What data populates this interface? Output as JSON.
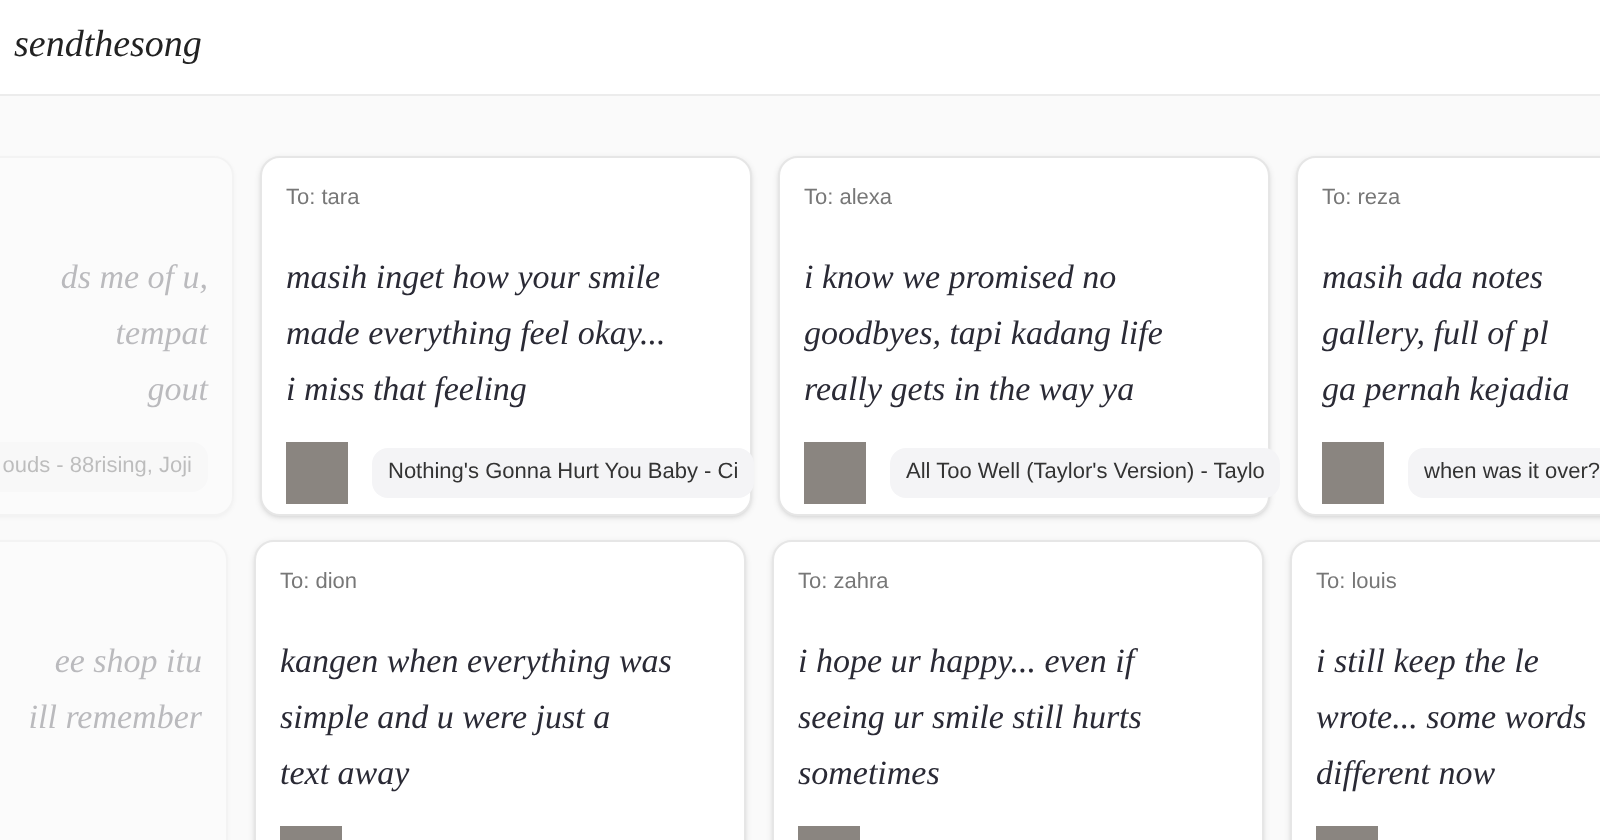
{
  "brand": "sendthesong",
  "rows": [
    {
      "cards": [
        {
          "faded": true,
          "lines": [
            "ds me of u,",
            "tempat",
            "gout"
          ],
          "song": "ouds - 88rising, Joji",
          "thumbnail": false
        },
        {
          "faded": false,
          "to": "To: tara",
          "lines": [
            "masih inget how your smile",
            "made everything feel okay...",
            "i miss that feeling"
          ],
          "song": "Nothing's Gonna Hurt You Baby - Ci",
          "thumbnail": true
        },
        {
          "faded": false,
          "to": "To: alexa",
          "lines": [
            "i know we promised no",
            "goodbyes, tapi kadang life",
            "really gets in the way ya"
          ],
          "song": "All Too Well (Taylor's Version) - Taylo",
          "thumbnail": true
        },
        {
          "faded": false,
          "to": "To: reza",
          "lines": [
            "masih ada notes",
            "gallery, full of pl",
            "ga pernah kejadia"
          ],
          "song": "when was it over?",
          "thumbnail": true
        }
      ]
    },
    {
      "cards": [
        {
          "faded": true,
          "lines": [
            "ee shop itu",
            "ill remember"
          ],
          "thumbnail": false
        },
        {
          "faded": false,
          "to": "To: dion",
          "lines": [
            "kangen when everything was",
            "simple and u were just a",
            "text away"
          ],
          "thumbnail": true
        },
        {
          "faded": false,
          "to": "To: zahra",
          "lines": [
            "i hope ur happy... even if",
            "seeing ur smile still hurts",
            "sometimes"
          ],
          "thumbnail": true
        },
        {
          "faded": false,
          "to": "To: louis",
          "lines": [
            "i still keep the le",
            "wrote... some words",
            "different now"
          ],
          "thumbnail": true
        }
      ]
    }
  ]
}
